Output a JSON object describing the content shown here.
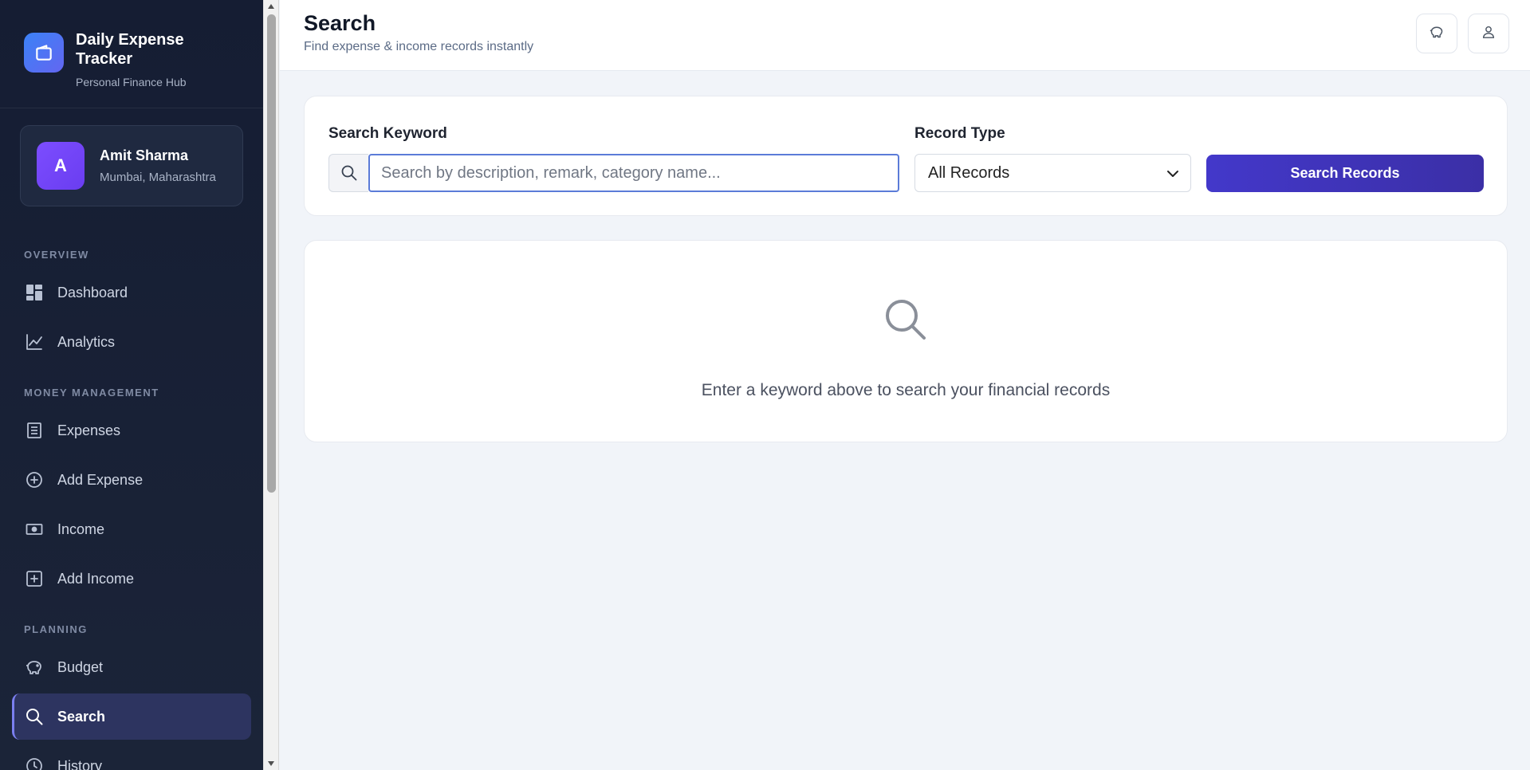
{
  "brand": {
    "title": "Daily Expense Tracker",
    "subtitle": "Personal Finance Hub"
  },
  "user": {
    "initial": "A",
    "name": "Amit Sharma",
    "location": "Mumbai, Maharashtra"
  },
  "sidebar": {
    "sections": [
      {
        "label": "OVERVIEW"
      },
      {
        "label": "MONEY MANAGEMENT"
      },
      {
        "label": "PLANNING"
      }
    ],
    "items": [
      {
        "label": "Dashboard",
        "icon": "dashboard-icon"
      },
      {
        "label": "Analytics",
        "icon": "chart-line-icon"
      },
      {
        "label": "Expenses",
        "icon": "receipt-icon"
      },
      {
        "label": "Add Expense",
        "icon": "plus-circle-icon"
      },
      {
        "label": "Income",
        "icon": "cash-icon"
      },
      {
        "label": "Add Income",
        "icon": "plus-square-icon"
      },
      {
        "label": "Budget",
        "icon": "piggy-bank-icon"
      },
      {
        "label": "Search",
        "icon": "search-icon",
        "active": true
      },
      {
        "label": "History",
        "icon": "clock-icon"
      }
    ]
  },
  "header": {
    "title": "Search",
    "subtitle": "Find expense & income records instantly"
  },
  "search": {
    "keyword_label": "Search Keyword",
    "keyword_placeholder": "Search by description, remark, category name...",
    "keyword_value": "",
    "type_label": "Record Type",
    "type_selected": "All Records",
    "submit_label": "Search Records"
  },
  "empty_state": {
    "message": "Enter a keyword above to search your financial records"
  },
  "colors": {
    "sidebar_bg": "#151d33",
    "accent": "#4338ca",
    "active_nav": "#2d3460",
    "page_bg": "#f1f4f9"
  }
}
